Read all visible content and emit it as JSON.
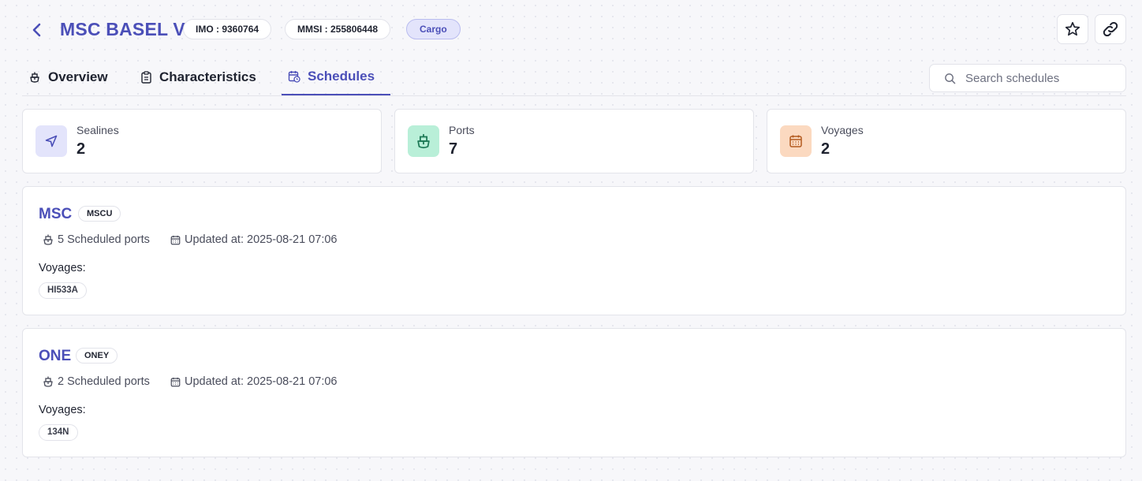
{
  "header": {
    "title": "MSC BASEL V",
    "imo": "IMO : 9360764",
    "mmsi": "MMSI : 255806448",
    "type_badge": "Cargo"
  },
  "tabs": [
    {
      "label": "Overview",
      "icon": "ship-icon"
    },
    {
      "label": "Characteristics",
      "icon": "clipboard-icon"
    },
    {
      "label": "Schedules",
      "icon": "calendar-clock-icon",
      "active": true
    }
  ],
  "search": {
    "placeholder": "Search schedules",
    "value": ""
  },
  "stats": [
    {
      "label": "Sealines",
      "value": "2",
      "icon": "navigation-icon",
      "color": "#e3e4fb"
    },
    {
      "label": "Ports",
      "value": "7",
      "icon": "ship-icon",
      "color": "#b9efd8"
    },
    {
      "label": "Voyages",
      "value": "2",
      "icon": "calendar-icon",
      "color": "#fbd9c0"
    }
  ],
  "carriers": [
    {
      "name": "MSC",
      "code": "MSCU",
      "ports": "5 Scheduled ports",
      "updated": "Updated at: 2025-08-21 07:06",
      "voyages_label": "Voyages:",
      "voyages": [
        "HI533A"
      ]
    },
    {
      "name": "ONE",
      "code": "ONEY",
      "ports": "2 Scheduled ports",
      "updated": "Updated at: 2025-08-21 07:06",
      "voyages_label": "Voyages:",
      "voyages": [
        "134N"
      ]
    }
  ],
  "colors": {
    "accent": "#4b4fb8",
    "background": "#f7f7fa"
  }
}
